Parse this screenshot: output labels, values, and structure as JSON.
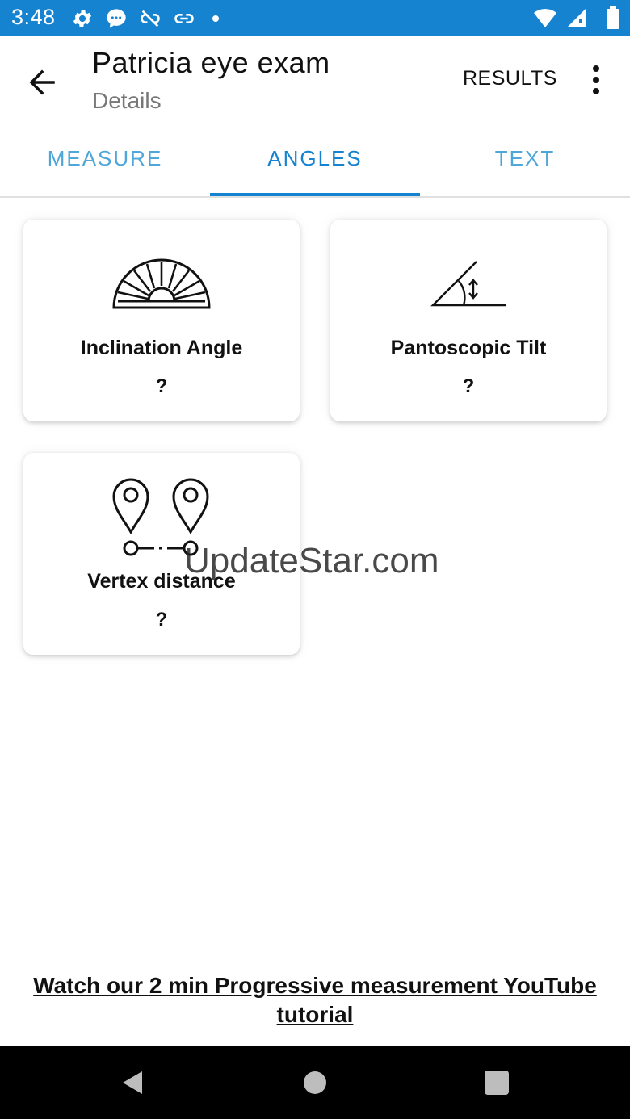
{
  "status_bar": {
    "time": "3:48",
    "left_icons": [
      "gear-icon",
      "chat-bubble-icon",
      "link-off-icon",
      "link-icon",
      "dot-icon"
    ],
    "right_icons": [
      "wifi-icon",
      "signal-icon",
      "battery-icon"
    ],
    "background": "#1683d0"
  },
  "app_bar": {
    "title": "Patricia eye exam",
    "subtitle": "Details",
    "results_label": "RESULTS"
  },
  "tabs": [
    {
      "label": "MEASURE",
      "active": false
    },
    {
      "label": "ANGLES",
      "active": true
    },
    {
      "label": "TEXT",
      "active": false
    }
  ],
  "cards": [
    {
      "label": "Inclination Angle",
      "value": "?",
      "icon": "protractor-icon"
    },
    {
      "label": "Pantoscopic Tilt",
      "value": "?",
      "icon": "angle-tilt-icon"
    },
    {
      "label": "Vertex distance",
      "value": "?",
      "icon": "map-pins-distance-icon"
    }
  ],
  "watermark": "UpdateStar.com",
  "tutorial_link": "Watch our 2 min Progressive measurement YouTube tutorial",
  "nav_bar": {
    "buttons": [
      "back-triangle-icon",
      "home-circle-icon",
      "recents-square-icon"
    ]
  },
  "colors": {
    "accent": "#1683d0",
    "tab_inactive": "#4ea6d9"
  }
}
